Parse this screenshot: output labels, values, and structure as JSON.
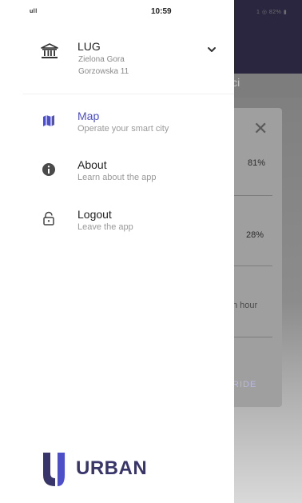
{
  "status": {
    "time": "10:59",
    "signal": "ull",
    "right": "1 ◎ 82% ▮"
  },
  "account": {
    "name": "LUG",
    "line1": "Zielona Gora",
    "line2": "Gorzowska 11",
    "icon": "bank-icon",
    "expand_icon": "chevron-down-icon"
  },
  "menu": [
    {
      "title": "Map",
      "subtitle": "Operate your smart city",
      "icon": "map-icon",
      "active": true
    },
    {
      "title": "About",
      "subtitle": "Learn about the app",
      "icon": "info-icon",
      "active": false
    },
    {
      "title": "Logout",
      "subtitle": "Leave the app",
      "icon": "lock-icon",
      "active": false
    }
  ],
  "logo": {
    "text": "URBAN"
  },
  "background": {
    "sub_title": "ici",
    "close": "✕",
    "pct1": "81%",
    "pct2": "28%",
    "hour": "n hour",
    "ride": "RIDE"
  },
  "colors": {
    "accent": "#4d4fc8",
    "brand": "#38356a",
    "header_dark": "#2a2640"
  }
}
